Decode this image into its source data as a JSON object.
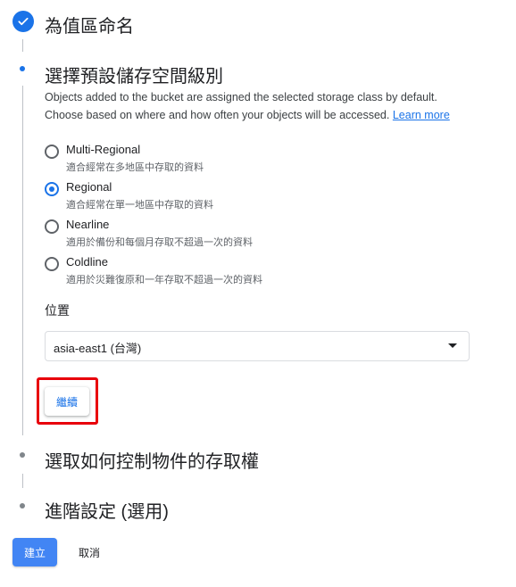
{
  "steps": [
    {
      "title": "為值區命名",
      "state": "completed"
    },
    {
      "title": "選擇預設儲存空間級別",
      "state": "active"
    },
    {
      "title": "選取如何控制物件的存取權",
      "state": "pending"
    },
    {
      "title": "進階設定 (選用)",
      "state": "pending"
    }
  ],
  "storage_class": {
    "description_line1": "Objects added to the bucket are assigned the selected storage class by default.",
    "description_line2": "Choose based on where and how often your objects will be accessed.",
    "learn_more": "Learn more",
    "options": [
      {
        "label": "Multi-Regional",
        "sub": "適合經常在多地區中存取的資料",
        "selected": false
      },
      {
        "label": "Regional",
        "sub": "適合經常在單一地區中存取的資料",
        "selected": true
      },
      {
        "label": "Nearline",
        "sub": "適用於備份和每個月存取不超過一次的資料",
        "selected": false
      },
      {
        "label": "Coldline",
        "sub": "適用於災難復原和一年存取不超過一次的資料",
        "selected": false
      }
    ]
  },
  "location": {
    "label": "位置",
    "value": "asia-east1 (台灣)"
  },
  "continue_label": "繼續",
  "footer": {
    "create_label": "建立",
    "cancel_label": "取消"
  },
  "colors": {
    "accent": "#1a73e8",
    "primary_button": "#4285f4",
    "highlight": "#e8000b"
  },
  "icons": {
    "step_completed": "check-circle-icon",
    "dropdown": "triangle-down-icon"
  }
}
